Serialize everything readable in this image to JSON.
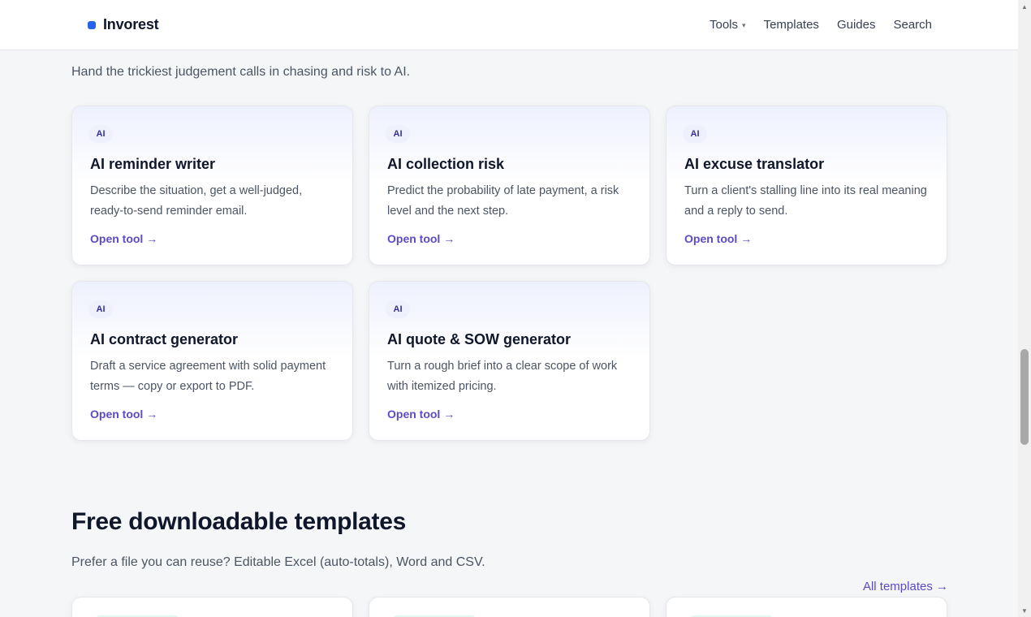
{
  "header": {
    "logo_text": "Invorest",
    "nav": [
      {
        "label": "Tools",
        "has_dropdown": true
      },
      {
        "label": "Templates",
        "has_dropdown": false
      },
      {
        "label": "Guides",
        "has_dropdown": false
      },
      {
        "label": "Search",
        "has_dropdown": false
      }
    ],
    "logo_color": "#2563eb"
  },
  "ai_section": {
    "intro": "Hand the trickiest judgement calls in chasing and risk to AI.",
    "cards": [
      {
        "badge": "AI",
        "title": "AI reminder writer",
        "description": "Describe the situation, get a well-judged, ready-to-send reminder email.",
        "link": "Open tool →"
      },
      {
        "badge": "AI",
        "title": "AI collection risk",
        "description": "Predict the probability of late payment, a risk level and the next step.",
        "link": "Open tool →"
      },
      {
        "badge": "AI",
        "title": "AI excuse translator",
        "description": "Turn a client's stalling line into its real meaning and a reply to send.",
        "link": "Open tool →"
      },
      {
        "badge": "AI",
        "title": "AI contract generator",
        "description": "Draft a service agreement with solid payment terms — copy or export to PDF.",
        "link": "Open tool →"
      },
      {
        "badge": "AI",
        "title": "AI quote & SOW generator",
        "description": "Turn a rough brief into a clear scope of work with itemized pricing.",
        "link": "Open tool →"
      }
    ]
  },
  "templates_section": {
    "title": "Free downloadable templates",
    "subtitle": "Prefer a file you can reuse? Editable Excel (auto-totals), Word and CSV.",
    "all_link": "All templates →"
  },
  "colors": {
    "accent": "#5b4bc4",
    "background": "#f5f6f8",
    "badge_text": "#3730a3"
  }
}
